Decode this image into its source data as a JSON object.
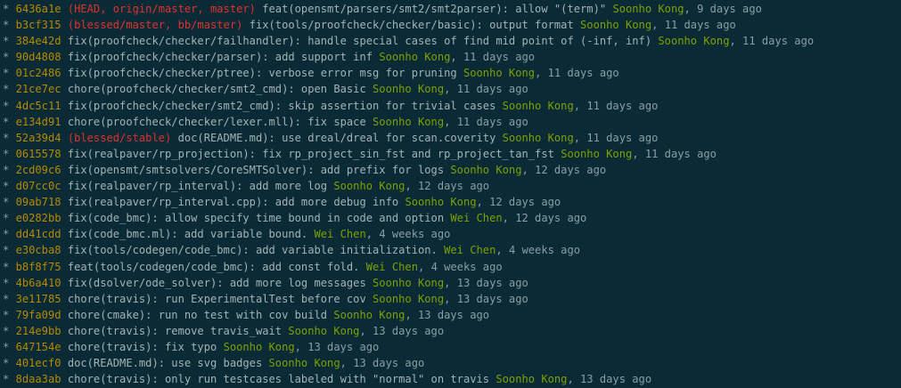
{
  "colors": {
    "background": "#0a2b36",
    "hash": "#b58900",
    "refs": "#dc322f",
    "author": "#7fa000",
    "message": "#a4b3b5",
    "graph": "#8b9ea3"
  },
  "log": [
    {
      "graph": "*",
      "hash": "6436a1e",
      "refs": "(HEAD, origin/master, master)",
      "message": "feat(opensmt/parsers/smt2/smt2parser): allow \"(term)\"",
      "author": "Soonho Kong",
      "date": "9 days ago"
    },
    {
      "graph": "*",
      "hash": "b3cf315",
      "refs": "(blessed/master, bb/master)",
      "message": "fix(tools/proofcheck/checker/basic): output format",
      "author": "Soonho Kong",
      "date": "11 days ago"
    },
    {
      "graph": "*",
      "hash": "384e42d",
      "refs": "",
      "message": "fix(proofcheck/checker/failhandler): handle special cases of find mid point of (-inf, inf)",
      "author": "Soonho Kong",
      "date": "11 days ago"
    },
    {
      "graph": "*",
      "hash": "90d4808",
      "refs": "",
      "message": "fix(proofcheck/checker/parser): add support inf",
      "author": "Soonho Kong",
      "date": "11 days ago"
    },
    {
      "graph": "*",
      "hash": "01c2486",
      "refs": "",
      "message": "fix(proofcheck/checker/ptree): verbose error msg for pruning",
      "author": "Soonho Kong",
      "date": "11 days ago"
    },
    {
      "graph": "*",
      "hash": "21ce7ec",
      "refs": "",
      "message": "chore(proofcheck/checker/smt2_cmd): open Basic",
      "author": "Soonho Kong",
      "date": "11 days ago"
    },
    {
      "graph": "*",
      "hash": "4dc5c11",
      "refs": "",
      "message": "fix(proofcheck/checker/smt2_cmd): skip assertion for trivial cases",
      "author": "Soonho Kong",
      "date": "11 days ago"
    },
    {
      "graph": "*",
      "hash": "e134d91",
      "refs": "",
      "message": "chore(proofcheck/checker/lexer.mll): fix space",
      "author": "Soonho Kong",
      "date": "11 days ago"
    },
    {
      "graph": "*",
      "hash": "52a39d4",
      "refs": "(blessed/stable)",
      "message": "doc(README.md): use dreal/dreal for scan.coverity",
      "author": "Soonho Kong",
      "date": "11 days ago"
    },
    {
      "graph": "*",
      "hash": "0615578",
      "refs": "",
      "message": "fix(realpaver/rp_projection): fix rp_project_sin_fst and rp_project_tan_fst",
      "author": "Soonho Kong",
      "date": "11 days ago"
    },
    {
      "graph": "*",
      "hash": "2cd09c6",
      "refs": "",
      "message": "fix(opensmt/smtsolvers/CoreSMTSolver): add prefix for logs",
      "author": "Soonho Kong",
      "date": "12 days ago"
    },
    {
      "graph": "*",
      "hash": "d07cc0c",
      "refs": "",
      "message": "fix(realpaver/rp_interval): add more log",
      "author": "Soonho Kong",
      "date": "12 days ago"
    },
    {
      "graph": "*",
      "hash": "09ab718",
      "refs": "",
      "message": "fix(realpaver/rp_interval.cpp): add more debug info",
      "author": "Soonho Kong",
      "date": "12 days ago"
    },
    {
      "graph": "*",
      "hash": "e0282bb",
      "refs": "",
      "message": "fix(code_bmc): allow specify time bound in code and option",
      "author": "Wei Chen",
      "date": "12 days ago"
    },
    {
      "graph": "*",
      "hash": "dd41cdd",
      "refs": "",
      "message": "fix(code_bmc.ml): add variable bound.",
      "author": "Wei Chen",
      "date": "4 weeks ago"
    },
    {
      "graph": "*",
      "hash": "e30cba8",
      "refs": "",
      "message": "fix(tools/codegen/code_bmc): add variable initialization.",
      "author": "Wei Chen",
      "date": "4 weeks ago"
    },
    {
      "graph": "*",
      "hash": "b8f8f75",
      "refs": "",
      "message": "feat(tools/codegen/code_bmc): add const fold.",
      "author": "Wei Chen",
      "date": "4 weeks ago"
    },
    {
      "graph": "*",
      "hash": "4b6a410",
      "refs": "",
      "message": "fix(dsolver/ode_solver): add more log messages",
      "author": "Soonho Kong",
      "date": "13 days ago"
    },
    {
      "graph": "*",
      "hash": "3e11785",
      "refs": "",
      "message": "chore(travis): run ExperimentalTest before cov",
      "author": "Soonho Kong",
      "date": "13 days ago"
    },
    {
      "graph": "*",
      "hash": "79fa09d",
      "refs": "",
      "message": "chore(cmake): run no test with cov build",
      "author": "Soonho Kong",
      "date": "13 days ago"
    },
    {
      "graph": "*",
      "hash": "214e9bb",
      "refs": "",
      "message": "chore(travis): remove travis_wait",
      "author": "Soonho Kong",
      "date": "13 days ago"
    },
    {
      "graph": "*",
      "hash": "647154e",
      "refs": "",
      "message": "chore(travis): fix typo",
      "author": "Soonho Kong",
      "date": "13 days ago"
    },
    {
      "graph": "*",
      "hash": "401ecf0",
      "refs": "",
      "message": "doc(README.md): use svg badges",
      "author": "Soonho Kong",
      "date": "13 days ago"
    },
    {
      "graph": "*",
      "hash": "8daa3ab",
      "refs": "",
      "message": "chore(travis): only run testcases labeled with \"normal\" on travis",
      "author": "Soonho Kong",
      "date": "13 days ago"
    }
  ]
}
